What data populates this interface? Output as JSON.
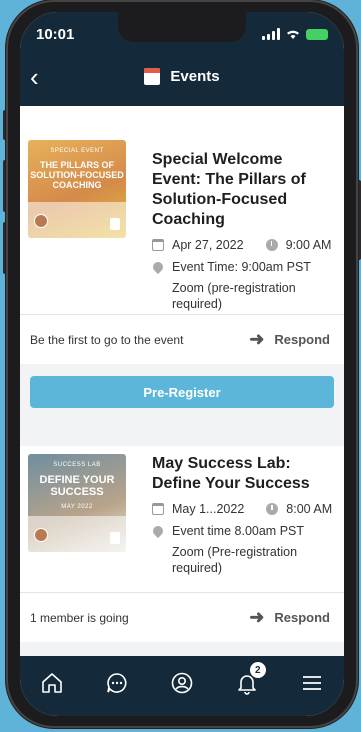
{
  "status_bar": {
    "time": "10:01"
  },
  "header": {
    "title": "Events",
    "back_glyph": "‹",
    "icon": "calendar-icon"
  },
  "events": [
    {
      "thumbnail": {
        "small_text": "SPECIAL EVENT",
        "headline": "THE PILLARS OF SOLUTION-FOCUSED COACHING"
      },
      "title": "Special Welcome Event: The Pillars of Solution-Focused Coaching",
      "date": "Apr 27, 2022",
      "time": "9:00 AM",
      "location_line": "Event Time: 9:00am PST",
      "venue": "Zoom (pre-registration required)",
      "attendance": "Be the first to go to the event",
      "respond_label": "Respond",
      "button_label": "Pre-Register"
    },
    {
      "thumbnail": {
        "small_text": "SUCCESS LAB",
        "headline": "DEFINE YOUR SUCCESS",
        "sub": "MAY 2022"
      },
      "title": "May Success Lab: Define Your Success",
      "date": "May 1...2022",
      "time": "8:00 AM",
      "location_line": "Event time 8.00am PST",
      "venue": "Zoom (Pre-registration required)",
      "attendance": "1 member is going",
      "respond_label": "Respond"
    }
  ],
  "tabbar": {
    "items": [
      "home-icon",
      "chat-icon",
      "profile-icon",
      "bell-icon",
      "menu-icon"
    ],
    "notification_count": "2"
  },
  "colors": {
    "header_bg": "#142a3a",
    "accent": "#5bb6d9",
    "page_bg": "#5fb3d9"
  }
}
